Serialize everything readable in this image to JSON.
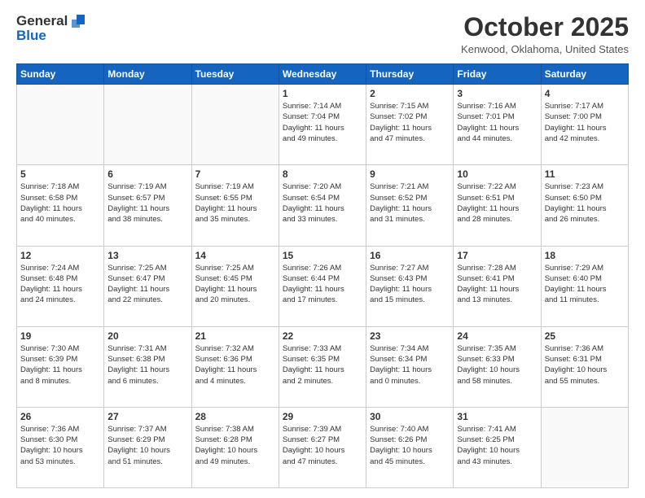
{
  "header": {
    "logo": {
      "line1": "General",
      "line2": "Blue"
    },
    "title": "October 2025",
    "location": "Kenwood, Oklahoma, United States"
  },
  "calendar": {
    "days_of_week": [
      "Sunday",
      "Monday",
      "Tuesday",
      "Wednesday",
      "Thursday",
      "Friday",
      "Saturday"
    ],
    "weeks": [
      [
        {
          "day": "",
          "info": ""
        },
        {
          "day": "",
          "info": ""
        },
        {
          "day": "",
          "info": ""
        },
        {
          "day": "1",
          "info": "Sunrise: 7:14 AM\nSunset: 7:04 PM\nDaylight: 11 hours\nand 49 minutes."
        },
        {
          "day": "2",
          "info": "Sunrise: 7:15 AM\nSunset: 7:02 PM\nDaylight: 11 hours\nand 47 minutes."
        },
        {
          "day": "3",
          "info": "Sunrise: 7:16 AM\nSunset: 7:01 PM\nDaylight: 11 hours\nand 44 minutes."
        },
        {
          "day": "4",
          "info": "Sunrise: 7:17 AM\nSunset: 7:00 PM\nDaylight: 11 hours\nand 42 minutes."
        }
      ],
      [
        {
          "day": "5",
          "info": "Sunrise: 7:18 AM\nSunset: 6:58 PM\nDaylight: 11 hours\nand 40 minutes."
        },
        {
          "day": "6",
          "info": "Sunrise: 7:19 AM\nSunset: 6:57 PM\nDaylight: 11 hours\nand 38 minutes."
        },
        {
          "day": "7",
          "info": "Sunrise: 7:19 AM\nSunset: 6:55 PM\nDaylight: 11 hours\nand 35 minutes."
        },
        {
          "day": "8",
          "info": "Sunrise: 7:20 AM\nSunset: 6:54 PM\nDaylight: 11 hours\nand 33 minutes."
        },
        {
          "day": "9",
          "info": "Sunrise: 7:21 AM\nSunset: 6:52 PM\nDaylight: 11 hours\nand 31 minutes."
        },
        {
          "day": "10",
          "info": "Sunrise: 7:22 AM\nSunset: 6:51 PM\nDaylight: 11 hours\nand 28 minutes."
        },
        {
          "day": "11",
          "info": "Sunrise: 7:23 AM\nSunset: 6:50 PM\nDaylight: 11 hours\nand 26 minutes."
        }
      ],
      [
        {
          "day": "12",
          "info": "Sunrise: 7:24 AM\nSunset: 6:48 PM\nDaylight: 11 hours\nand 24 minutes."
        },
        {
          "day": "13",
          "info": "Sunrise: 7:25 AM\nSunset: 6:47 PM\nDaylight: 11 hours\nand 22 minutes."
        },
        {
          "day": "14",
          "info": "Sunrise: 7:25 AM\nSunset: 6:45 PM\nDaylight: 11 hours\nand 20 minutes."
        },
        {
          "day": "15",
          "info": "Sunrise: 7:26 AM\nSunset: 6:44 PM\nDaylight: 11 hours\nand 17 minutes."
        },
        {
          "day": "16",
          "info": "Sunrise: 7:27 AM\nSunset: 6:43 PM\nDaylight: 11 hours\nand 15 minutes."
        },
        {
          "day": "17",
          "info": "Sunrise: 7:28 AM\nSunset: 6:41 PM\nDaylight: 11 hours\nand 13 minutes."
        },
        {
          "day": "18",
          "info": "Sunrise: 7:29 AM\nSunset: 6:40 PM\nDaylight: 11 hours\nand 11 minutes."
        }
      ],
      [
        {
          "day": "19",
          "info": "Sunrise: 7:30 AM\nSunset: 6:39 PM\nDaylight: 11 hours\nand 8 minutes."
        },
        {
          "day": "20",
          "info": "Sunrise: 7:31 AM\nSunset: 6:38 PM\nDaylight: 11 hours\nand 6 minutes."
        },
        {
          "day": "21",
          "info": "Sunrise: 7:32 AM\nSunset: 6:36 PM\nDaylight: 11 hours\nand 4 minutes."
        },
        {
          "day": "22",
          "info": "Sunrise: 7:33 AM\nSunset: 6:35 PM\nDaylight: 11 hours\nand 2 minutes."
        },
        {
          "day": "23",
          "info": "Sunrise: 7:34 AM\nSunset: 6:34 PM\nDaylight: 11 hours\nand 0 minutes."
        },
        {
          "day": "24",
          "info": "Sunrise: 7:35 AM\nSunset: 6:33 PM\nDaylight: 10 hours\nand 58 minutes."
        },
        {
          "day": "25",
          "info": "Sunrise: 7:36 AM\nSunset: 6:31 PM\nDaylight: 10 hours\nand 55 minutes."
        }
      ],
      [
        {
          "day": "26",
          "info": "Sunrise: 7:36 AM\nSunset: 6:30 PM\nDaylight: 10 hours\nand 53 minutes."
        },
        {
          "day": "27",
          "info": "Sunrise: 7:37 AM\nSunset: 6:29 PM\nDaylight: 10 hours\nand 51 minutes."
        },
        {
          "day": "28",
          "info": "Sunrise: 7:38 AM\nSunset: 6:28 PM\nDaylight: 10 hours\nand 49 minutes."
        },
        {
          "day": "29",
          "info": "Sunrise: 7:39 AM\nSunset: 6:27 PM\nDaylight: 10 hours\nand 47 minutes."
        },
        {
          "day": "30",
          "info": "Sunrise: 7:40 AM\nSunset: 6:26 PM\nDaylight: 10 hours\nand 45 minutes."
        },
        {
          "day": "31",
          "info": "Sunrise: 7:41 AM\nSunset: 6:25 PM\nDaylight: 10 hours\nand 43 minutes."
        },
        {
          "day": "",
          "info": ""
        }
      ]
    ]
  }
}
